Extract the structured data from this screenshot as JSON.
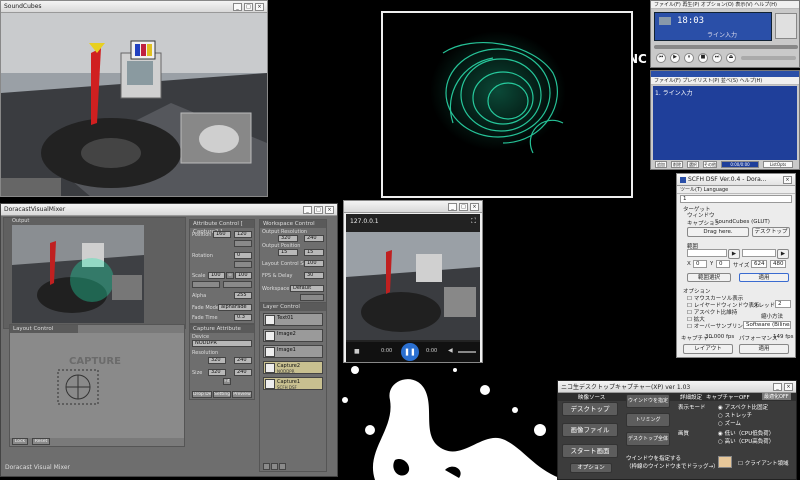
{
  "colors": {
    "accent": "#23e8b0",
    "desktop": "#000000",
    "mixer_bg": "#6e6e6e",
    "player_blue": "#2a4fa8"
  },
  "soundcubes": {
    "title": "SoundCubes"
  },
  "visualizer": {},
  "winamp": {
    "menu": [
      "ファイル(F)",
      "再生(P)",
      "オプション(O)",
      "表示(V)",
      "ヘルプ(H)"
    ],
    "time": "18:03",
    "track": "ライン入力",
    "playlist_menu": [
      "ファイル(F)",
      "プレイリスト(P)",
      "並べ(S)",
      "ヘルプ(H)"
    ],
    "playlist_item": "1. ライン入力",
    "bottom_buttons": [
      "追加",
      "削除",
      "選択",
      "その他",
      "0:00/0:00",
      "ListOpts"
    ]
  },
  "scfh": {
    "title": "SCFH DSF Ver.0.4 - Dora...",
    "menu": [
      "ツール(T)",
      "Language"
    ],
    "index": "1",
    "target_label": "ターゲット",
    "window_label": "ウィンドウ",
    "caption_label": "キャプション",
    "caption_value": "SoundCubes (GLUT)",
    "drag_here": "Drag here.",
    "desktop_btn": "デスクトップ",
    "area_label": "範囲",
    "x_label": "X",
    "x_value": "0",
    "y_label": "Y",
    "y_value": "0",
    "size_label": "サイズ",
    "w_value": "624",
    "h_value": "480",
    "select_area_btn": "範囲選択",
    "apply_btn": "適用",
    "options_label": "オプション",
    "opt_mouse": "マウスカーソル表示",
    "opt_layered": "レイヤードウィンドウ表示",
    "opt_aspect": "アスペクト比維持",
    "opt_zoom": "拡大",
    "opt_oversample": "オーバーサンプリング",
    "thread_label": "スレッド数",
    "thread_value": "2",
    "shrink_label": "縮小方法",
    "shrink_value": "Software (Bilinear)",
    "capture_label": "キャプチャー",
    "capture_fps": "30.000 fps",
    "perf_label": "パフォーマンス",
    "perf_fps": "149 fps",
    "layout_btn": "レイアウト",
    "apply2_btn": "適用"
  },
  "mixer": {
    "title": "DoracastVisualMixer",
    "output_label": "Output",
    "layout_control": "Layout Control",
    "capture_text": "CAPTURE",
    "layout_btns": [
      "Lock",
      "Reset"
    ],
    "footer": "Doracast Visual Mixer",
    "attr_title": "Attribute Control",
    "attr_title_note": "[ Capture2 ]",
    "position": "Position",
    "pos_x": "160",
    "pos_y": "120",
    "rotation": "Rotation",
    "rot": "0",
    "scale": "Scale",
    "scale_w": "100",
    "scale_h": "100",
    "alpha": "Alpha",
    "alpha_v": "255",
    "fade_mode": "Fade Mode",
    "fade_mode_v": "alphaFade",
    "fade_time": "Fade Time",
    "fade_time_v": "0.3",
    "capture_attr": "Capture Attribute",
    "device": "Device",
    "device_v": "NODDPR",
    "resolution": "Resolution",
    "res_w": "320",
    "res_h": "240",
    "size": "Size",
    "size_w": "320",
    "size_h": "240",
    "fit": "Fit",
    "cap_btns": [
      "Drop Dev",
      "Setting",
      "Preview"
    ],
    "ws_title": "Workspace Control",
    "out_res": "Output Resolution",
    "out_res_w": "320",
    "out_res_h": "240",
    "out_pos": "Output Position",
    "out_pos_x": "15",
    "out_pos_y": "15",
    "layout_scale": "Layout Control Scale",
    "layout_scale_v": "100",
    "fps_delay": "FPS & Delay",
    "fps_v": "30",
    "workspace": "Workspace",
    "workspace_v": "Default",
    "layer_ctrl": "Layer Control",
    "layers": [
      {
        "name": "Text01",
        "sub": ""
      },
      {
        "name": "Image2",
        "sub": ""
      },
      {
        "name": "Image1",
        "sub": ""
      },
      {
        "name": "Capture2",
        "sub": "NODDPR"
      },
      {
        "name": "Capture1",
        "sub": "SCFH DSF"
      }
    ]
  },
  "player": {
    "address": "127.0.0.1",
    "time_left": "0:00",
    "time_right": "0:00"
  },
  "nico": {
    "title": "ニコ生デスクトップキャプチャー(XP) ver 1.03",
    "menu": [
      "映像ソース",
      "詳細設定",
      "キャプチャーOFF",
      "最適化OFF"
    ],
    "source_btns": [
      "デスクトップ",
      "画像ファイル",
      "スタート画面"
    ],
    "option_btn": "オプション",
    "mid_btns": [
      "ウインドウを指定",
      "トリミング",
      "デスクトップ全体"
    ],
    "display_mode": "表示モード",
    "modes": [
      "アスペクト比固定",
      "ストレッチ",
      "ズーム"
    ],
    "quality": "画質",
    "qualities": [
      "低い（CPU低負荷）",
      "高い（CPU高負荷）"
    ],
    "window_hint1": "ウインドウを指定する",
    "window_hint2": "（枠線のウインドウまでドラッグ→）",
    "client_area": "クライアント領域"
  }
}
